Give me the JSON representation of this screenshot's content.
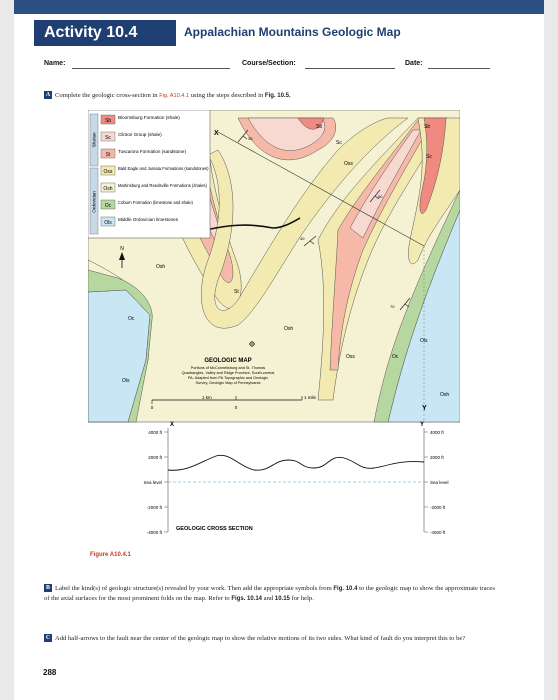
{
  "header": {
    "activity": "Activity 10.4",
    "title": "Appalachian Mountains Geologic Map"
  },
  "fields": {
    "name": "Name:",
    "course": "Course/Section:",
    "date": "Date:"
  },
  "step_a": {
    "letter": "A",
    "text": "Complete the geologic cross-section in",
    "fig_ref": "Fig. A10.4.1",
    "text2": "using the steps described in",
    "fig_ref2": "Fig. 10.5."
  },
  "legend": {
    "groups": [
      "Silurian",
      "Ordovician"
    ],
    "items": [
      {
        "code": "Sb",
        "label": "Bloomsburg Formation (shale)",
        "color": "#f08a80"
      },
      {
        "code": "Sc",
        "label": "Clinton Group (shale)",
        "color": "#f7d9d2"
      },
      {
        "code": "St",
        "label": "Tuscarora Formation (sandstone)",
        "color": "#f6b9a7"
      },
      {
        "code": "Oss",
        "label": "Bald Eagle and Juniata Formations (sandstones)",
        "color": "#f2eab0"
      },
      {
        "code": "Osh",
        "label": "Martinsburg and Reedsville Formations (shales)",
        "color": "#f4f2d2"
      },
      {
        "code": "Oc",
        "label": "Coburn Formation (limestone and shale)",
        "color": "#b6d8a0"
      },
      {
        "code": "Ols",
        "label": "Middle Ordovician limestones",
        "color": "#c9e6f4"
      }
    ]
  },
  "map": {
    "title": "GEOLOGIC MAP",
    "desc": [
      "Portions of McConnellsburg and St. Thomas",
      "Quadrangles, Valley and Ridge Province, South-central",
      "PA. Adapted from PA Topographic and Geologic",
      "Survey, Geologic Map of Pennsylvania"
    ],
    "north": "N",
    "scale": [
      "0",
      "1 km",
      "0",
      "1 mile"
    ],
    "labels": {
      "x": "X",
      "y": "Y",
      "sb1": "Sb",
      "sc1": "Sc",
      "sb2": "Sb",
      "sc2": "Sc",
      "oss1": "Oss",
      "osh1": "Osh",
      "st": "St",
      "osh2": "Osh",
      "oc1": "Oc",
      "ols1": "Ols",
      "oss2": "Oss",
      "oc2": "Oc",
      "ols2": "Ols",
      "osh3": "Osh",
      "dip1": "35",
      "dip2": "40",
      "dip3": "50",
      "dip4": "70"
    },
    "colors": {
      "ols": "#c9e6f4",
      "oc": "#b6d8a0",
      "osh": "#f4f2d2",
      "oss": "#f2eab0",
      "st": "#f6b9a7",
      "sc": "#f7d9d2",
      "sb": "#f08a80"
    }
  },
  "cross_section": {
    "title": "GEOLOGIC CROSS SECTION",
    "left_ticks": [
      "4000 ft",
      "2000 ft",
      "Sea level",
      "-2000 ft",
      "-4000 ft"
    ],
    "right_ticks": [
      "4000 ft",
      "2000 ft",
      "Sea level",
      "-2000 ft",
      "-4000 ft"
    ]
  },
  "caption": "Figure A10.4.1",
  "step_b": {
    "letter": "B",
    "text1": "Label the kind(s) of geologic structure(s) revealed by your work. Then add the appropriate symbols from",
    "ref1": "Fig. 10.4",
    "text2": "to the geologic map to show the approximate traces of the axial surfaces for the most prominent folds on the map. Refer to",
    "ref2": "Figs. 10.14",
    "text3": "and",
    "ref3": "10.15",
    "text4": "for help."
  },
  "step_c": {
    "letter": "C",
    "text": "Add half-arrows to the fault near the center of the geologic map to show the relative motions of its two sides. What kind of fault do you interpret this to be?"
  },
  "page_number": "288"
}
